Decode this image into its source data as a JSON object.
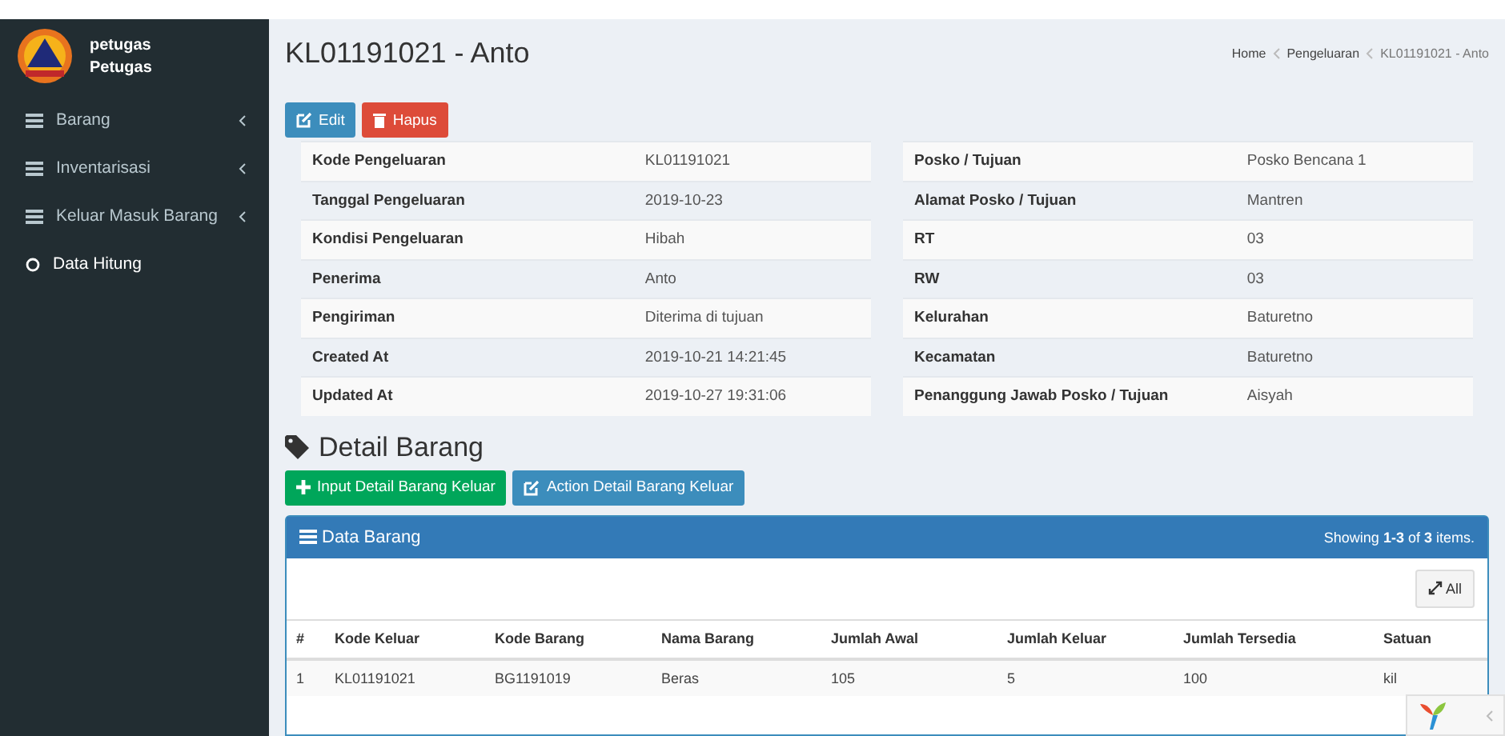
{
  "user": {
    "name": "petugas",
    "role": "Petugas"
  },
  "sidebar": {
    "items": [
      {
        "label": "Barang",
        "kind": "menu"
      },
      {
        "label": "Inventarisasi",
        "kind": "menu"
      },
      {
        "label": "Keluar Masuk Barang",
        "kind": "menu"
      },
      {
        "label": "Data Hitung",
        "kind": "link"
      }
    ]
  },
  "page": {
    "title": "KL01191021 - Anto",
    "breadcrumb": [
      "Home",
      "Pengeluaran",
      "KL01191021 - Anto"
    ]
  },
  "actions": [
    {
      "label": "Edit",
      "kind": "edit"
    },
    {
      "label": "Hapus",
      "kind": "delete"
    }
  ],
  "details_left": [
    {
      "label": "Kode Pengeluaran",
      "value": "KL01191021"
    },
    {
      "label": "Tanggal Pengeluaran",
      "value": "2019-10-23"
    },
    {
      "label": "Kondisi Pengeluaran",
      "value": "Hibah"
    },
    {
      "label": "Penerima",
      "value": "Anto"
    },
    {
      "label": "Pengiriman",
      "value": "Diterima di tujuan"
    },
    {
      "label": "Created At",
      "value": "2019-10-21 14:21:45"
    },
    {
      "label": "Updated At",
      "value": "2019-10-27 19:31:06"
    }
  ],
  "details_right": [
    {
      "label": "Posko / Tujuan",
      "value": "Posko Bencana 1"
    },
    {
      "label": "Alamat Posko / Tujuan",
      "value": "Mantren"
    },
    {
      "label": "RT",
      "value": "03"
    },
    {
      "label": "RW",
      "value": "03"
    },
    {
      "label": "Kelurahan",
      "value": "Baturetno"
    },
    {
      "label": "Kecamatan",
      "value": "Baturetno"
    },
    {
      "label": "Penanggung Jawab Posko / Tujuan",
      "value": "Aisyah"
    }
  ],
  "section": {
    "title": "Detail Barang",
    "buttons": [
      {
        "label": "Input Detail Barang Keluar",
        "kind": "add"
      },
      {
        "label": "Action Detail Barang Keluar",
        "kind": "edit"
      }
    ]
  },
  "panel": {
    "title": "Data Barang",
    "summary": "Showing **1-3** of **3** items.",
    "toggle": "All",
    "table": {
      "columns": [
        "#",
        "Kode Keluar",
        "Kode Barang",
        "Nama Barang",
        "Jumlah Awal",
        "Jumlah Keluar",
        "Jumlah Tersedia",
        "Satuan"
      ],
      "rows": [
        [
          "1",
          "KL01191021",
          "BG1191019",
          "Beras",
          "105",
          "5",
          "100",
          "kil"
        ]
      ]
    }
  }
}
